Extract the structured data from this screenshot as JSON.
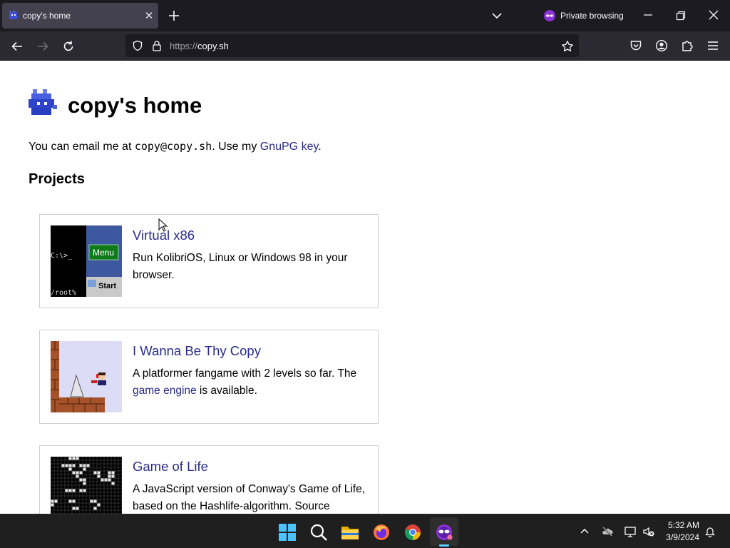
{
  "browser": {
    "tab": {
      "title": "copy's home"
    },
    "private_label": "Private browsing",
    "url": {
      "protocol": "https://",
      "host": "copy.sh"
    }
  },
  "page": {
    "title": "copy's home",
    "intro": {
      "before": "You can email me at ",
      "email": "copy@copy.sh",
      "middle": ". Use my ",
      "link": "GnuPG key",
      "after": "."
    },
    "projects_heading": "Projects",
    "projects": [
      {
        "title": "Virtual x86",
        "description": "Run KolibriOS, Linux or Windows 98 in your browser.",
        "thumb": {
          "prompt": "C:\\>_",
          "menu": "Menu",
          "root": "/root%",
          "start": "Start"
        }
      },
      {
        "title": "I Wanna Be Thy Copy",
        "description_before": "A platformer fangame with 2 levels so far. The ",
        "description_link": "game engine",
        "description_after": " is available."
      },
      {
        "title": "Game of Life",
        "description": "A JavaScript version of Conway's Game of Life, based on the Hashlife-algorithm. Source"
      }
    ]
  },
  "taskbar": {
    "time": "5:32 AM",
    "date": "3/9/2024"
  },
  "colors": {
    "link": "#2a2a8a",
    "tabbar": "#1c1b22",
    "navbar": "#2b2a33",
    "taskbar": "#1f1f1f"
  }
}
